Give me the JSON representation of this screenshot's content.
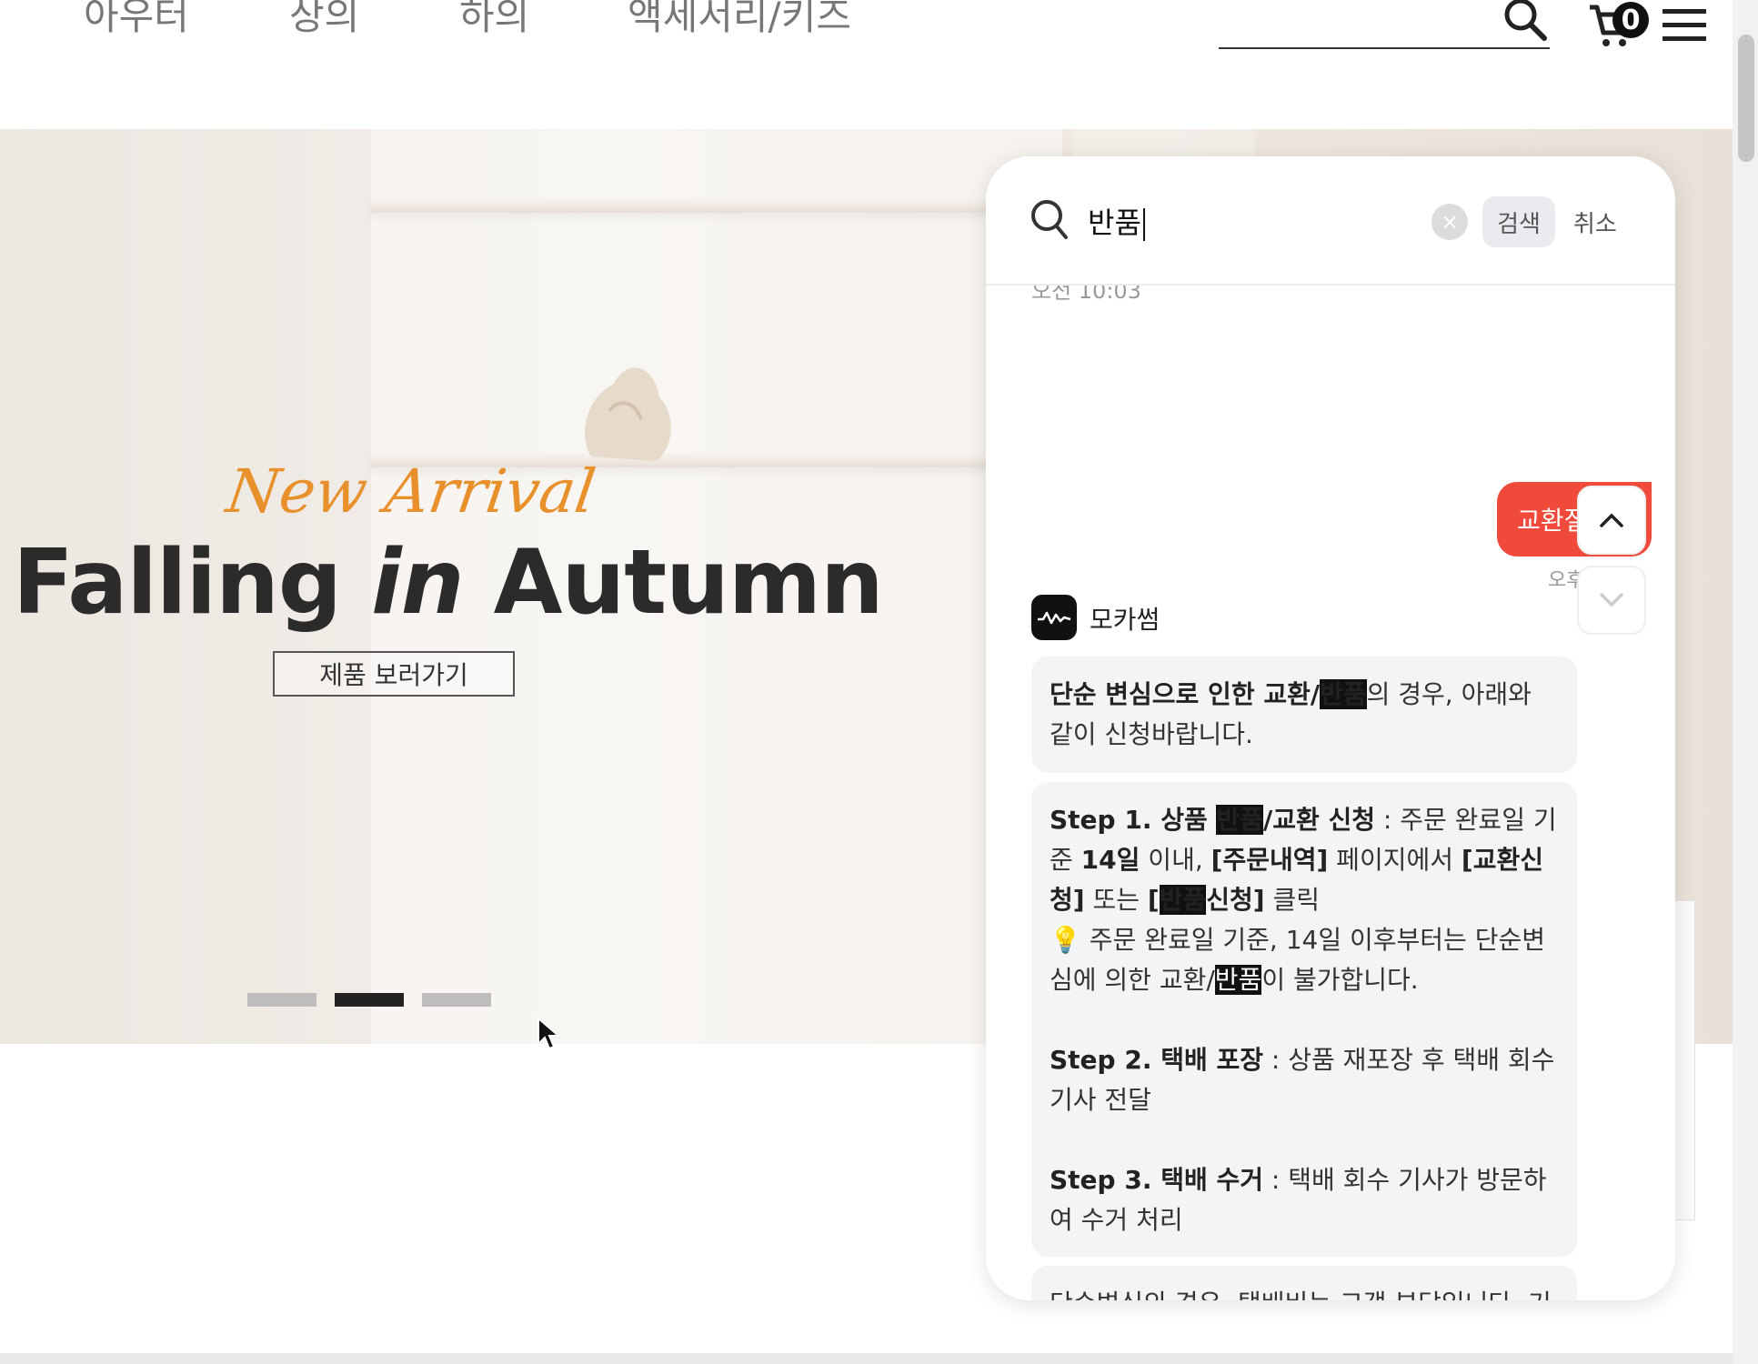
{
  "header": {
    "nav": [
      "아우터",
      "상의",
      "하의",
      "액세서리/키즈"
    ],
    "cart_count": "0"
  },
  "hero": {
    "script_text": "New Arrival",
    "title_part1": "Falling ",
    "title_part2": "in",
    "title_part3": " Autumn",
    "button_label": "제품 보러가기",
    "slide_count": 3,
    "active_slide": 2
  },
  "chat": {
    "search": {
      "query": "반품",
      "clear_label": "×",
      "search_label": "검색",
      "cancel_label": "취소"
    },
    "prev_time": "오전 10:03",
    "user_message": "교환절",
    "user_time": "오후",
    "bot_name": "모카썸",
    "messages": {
      "m1_bold1": "단순 변심으로 인한 교환/",
      "m1_hl": "반품",
      "m1_rest": "의 경우, 아래와 같이 신청바랍니다.",
      "s1_bold": "Step 1. 상품 ",
      "s1_hl": "반품",
      "s1_bold2": "/교환 신청",
      "s1_t1": " : 주문 완료일 기준 ",
      "s1_b3": "14일",
      "s1_t2": " 이내, ",
      "s1_b4": "[주문내역]",
      "s1_t3": " 페이지에서 ",
      "s1_b5": "[교환신청]",
      "s1_t4": " 또는 ",
      "s1_b6": "[",
      "s1_hl2": "반품",
      "s1_b7": "신청]",
      "s1_t5": " 클릭",
      "s1_tip_icon": "💡",
      "s1_tip1": " 주문 완료일 기준, 14일 이후부터는 단순변심에 의한 교환/",
      "s1_tip_hl": "반품",
      "s1_tip2": "이 불가합니다.",
      "s2_bold": "Step 2. 택배 포장",
      "s2_text": " : 상품 재포장 후 택배 회수 기사 전달",
      "s3_bold": "Step 3. 택배 수거",
      "s3_text": " : 택배 회수 기사가 방문하여 수거 처리",
      "m3_text": "단순변심의 경우, 택배비는 고객 부담입니다. 기타 궁금하신 사항은 고객센터로 문의해주시기 바랍니다."
    }
  },
  "colors": {
    "accent": "#f04a3a",
    "script": "#e8912c",
    "highlight_bg": "#111111"
  },
  "icons": [
    "search-icon",
    "cart-icon",
    "menu-icon",
    "chevron-up-icon",
    "chevron-down-icon",
    "bot-wave-icon",
    "lightbulb-icon"
  ]
}
